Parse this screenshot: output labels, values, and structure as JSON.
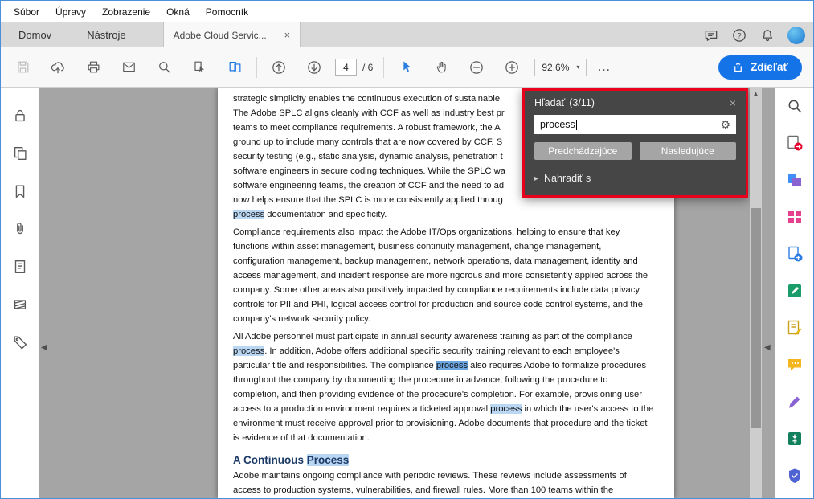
{
  "menubar": {
    "items": [
      {
        "label": "Súbor"
      },
      {
        "label": "Úpravy"
      },
      {
        "label": "Zobrazenie"
      },
      {
        "label": "Okná"
      },
      {
        "label": "Pomocník"
      }
    ]
  },
  "tabbar": {
    "home_label": "Domov",
    "tools_label": "Nástroje",
    "doc_tab_label": "Adobe Cloud Servic...",
    "doc_tab_close": "×"
  },
  "toolbar": {
    "page_current": "4",
    "page_total": "/ 6",
    "zoom_value": "92.6%",
    "zoom_caret": "▾",
    "more_label": "...",
    "share_label": "Zdieľať"
  },
  "search_panel": {
    "title": "Hľadať",
    "count": "(3/11)",
    "close": "×",
    "query": "process",
    "gear": "⚙",
    "prev_label": "Predchádzajúce",
    "next_label": "Nasledujúce",
    "expand_arrow": "▸",
    "replace_label": "Nahradiť s"
  },
  "viewer": {
    "left_collapse": "◀",
    "right_collapse": "◀",
    "scroll_up": "▲"
  },
  "document": {
    "intro_line": "strategic simplicity enables the continuous execution of sustainable",
    "p1": [
      {
        "t": "The Adobe SPLC aligns cleanly with CCF as well as industry best pr"
      },
      {
        "br": true
      },
      {
        "t": "teams to meet compliance requirements. A robust framework, the A"
      },
      {
        "br": true
      },
      {
        "t": "ground up to include many controls that are now covered by CCF. S"
      },
      {
        "br": true
      },
      {
        "t": "security testing (e.g., static analysis, dynamic analysis, penetration t"
      },
      {
        "br": true
      },
      {
        "t": "software engineers in secure coding techniques. While the SPLC wa"
      },
      {
        "br": true
      },
      {
        "t": "software engineering teams, the creation of CCF and the need to ad"
      },
      {
        "br": true
      },
      {
        "t": "now helps ensure that the SPLC is more consistently applied throug"
      },
      {
        "br": true
      },
      {
        "t": "process",
        "h": 1
      },
      {
        "t": " documentation and specificity."
      }
    ],
    "p2": [
      {
        "t": "Compliance requirements also impact the Adobe IT/Ops organizations, helping to ensure that key functions within asset management, business continuity management, change management, configuration management, backup management, network operations, data management, identity and access management, and incident response are more rigorous and more consistently applied across the company. Some other areas also positively impacted by compliance requirements include data privacy controls for PII and PHI, logical access control for production and source code control systems, and the company's network security policy."
      }
    ],
    "p3": [
      {
        "t": "All Adobe personnel must participate in annual security awareness training as part of the compliance "
      },
      {
        "t": "process",
        "h": 1
      },
      {
        "t": ". In addition, Adobe offers additional specific security training relevant to each employee's particular title and responsibilities. The compliance "
      },
      {
        "t": "process",
        "h": 2
      },
      {
        "t": " also requires Adobe to formalize procedures throughout the company by documenting the procedure in advance, following the procedure to completion, and then providing evidence of the procedure's completion. For example, provisioning user access to a production environment requires a ticketed approval "
      },
      {
        "t": "process",
        "h": 1
      },
      {
        "t": " in which the user's access to the environment must receive approval prior to provisioning. Adobe documents that procedure and the ticket is evidence of that documentation."
      }
    ],
    "heading": [
      {
        "t": "A Continuous "
      },
      {
        "t": "Process",
        "h": 1
      }
    ],
    "p4": [
      {
        "t": "Adobe maintains ongoing compliance with periodic reviews. These reviews include assessments of access to production systems, vulnerabilities, and firewall rules. More than 100 teams within the"
      }
    ]
  },
  "colors": {
    "accent_blue": "#1473e6",
    "highlight": "#b9d6f2",
    "highlight_current": "#6ca6e0",
    "panel_border_red": "#e8001c",
    "panel_bg": "#464646"
  }
}
